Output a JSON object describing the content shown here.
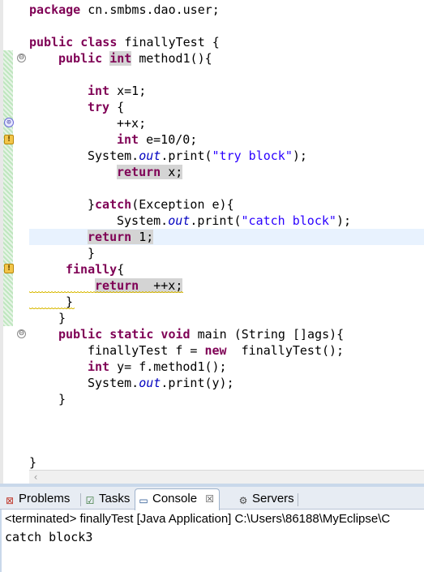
{
  "editor": {
    "lines": {
      "l1": {
        "kw": "package",
        "rest": " cn.smbms.dao.user;"
      },
      "l3": {
        "kw": "public class",
        "rest": " finallyTest {"
      },
      "l4": {
        "kw1": "public",
        "kw2": "int",
        "rest": " method1(){"
      },
      "l6": {
        "kw": "int",
        "rest": " x=1;"
      },
      "l7": {
        "kw": "try",
        "rest": " {"
      },
      "l8": {
        "text": "++x;"
      },
      "l9": {
        "kw": "int",
        "rest": " e=10/0;"
      },
      "l10": {
        "pre": "System.",
        "field": "out",
        "mid": ".print(",
        "str": "\"try block\"",
        "post": ");"
      },
      "l11": {
        "kw": "return",
        "rest": " x;"
      },
      "l13": {
        "pre": "}",
        "kw": "catch",
        "rest": "(Exception e){"
      },
      "l14": {
        "pre": "System.",
        "field": "out",
        "mid": ".print(",
        "str": "\"catch block\"",
        "post": ");"
      },
      "l15": {
        "kw": "return",
        "rest": " 1;"
      },
      "l16": {
        "text": "}"
      },
      "l17": {
        "kw": "finally",
        "rest": "{"
      },
      "l18": {
        "kw": "return",
        "rest": "  ++x;"
      },
      "l19": {
        "text": "}"
      },
      "l20": {
        "text": "}"
      },
      "l21": {
        "kw": "public static void",
        "rest": " main (String []ags){"
      },
      "l22": {
        "pre": "finallyTest f = ",
        "kw": "new",
        "rest": "  finallyTest();"
      },
      "l23": {
        "kw": "int",
        "rest": " y= f.method1();"
      },
      "l24": {
        "pre": "System.",
        "field": "out",
        "mid": ".print(y);"
      },
      "l25": {
        "text": "}"
      },
      "l30": {
        "text": "}"
      }
    },
    "fold_glyph": "⊖",
    "hscroll_arrow": "‹",
    "markers": {
      "bp_icon": "breakpoint-icon",
      "warn_icon": "warning-icon",
      "bp_glyph": "⊙",
      "warn_glyph": "!"
    }
  },
  "console": {
    "tabs": {
      "problems": {
        "label": "Problems",
        "icon": "problems-icon",
        "glyph": "⊠"
      },
      "tasks": {
        "label": "Tasks",
        "icon": "tasks-icon",
        "glyph": "☑"
      },
      "console": {
        "label": "Console",
        "icon": "console-icon",
        "glyph": "▭",
        "close": "☒"
      },
      "servers": {
        "label": "Servers",
        "icon": "servers-icon",
        "glyph": "⚙"
      }
    },
    "terminated_line": "<terminated> finallyTest [Java Application] C:\\Users\\86188\\MyEclipse\\C",
    "output": "catch block3"
  },
  "colors": {
    "keyword": "#7f0055",
    "string": "#2a00ff",
    "field": "#0000c0",
    "current_line": "#e8f2fe"
  }
}
